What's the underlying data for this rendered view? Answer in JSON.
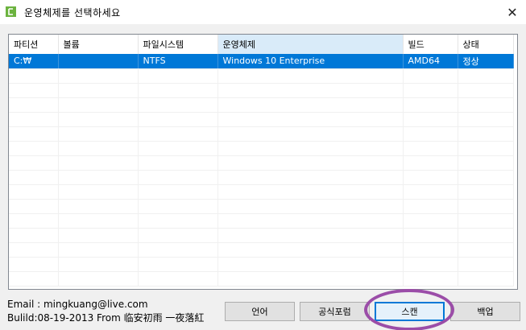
{
  "window": {
    "title": "운영체제를 선택하세요",
    "close_glyph": "✕"
  },
  "table": {
    "columns": [
      "파티션",
      "볼륨",
      "파일시스템",
      "운영체제",
      "빌드",
      "상태"
    ],
    "rows": [
      [
        "C:₩",
        "",
        "NTFS",
        "Windows 10 Enterprise",
        "AMD64",
        "정상"
      ]
    ]
  },
  "footer": {
    "email": "Email : mingkuang@live.com",
    "build": "Bulild:08-19-2013 From 临安初雨 一夜落紅"
  },
  "buttons": {
    "language": "언어",
    "forum": "공식포럼",
    "scan": "스캔",
    "backup": "백업"
  },
  "colors": {
    "selection": "#0078d7",
    "annotation_ring": "#9b4da8"
  }
}
